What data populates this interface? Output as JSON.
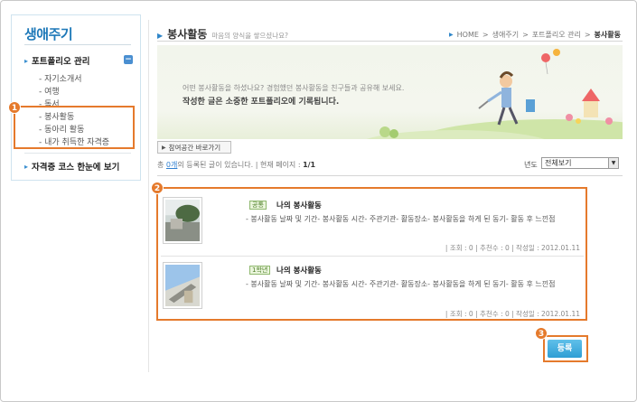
{
  "sidebar": {
    "title": "생애주기",
    "section1": "포트폴리오 관리",
    "items": [
      "자기소개서",
      "여행",
      "독서",
      "봉사활동",
      "동아리 활동",
      "내가 취득한 자격증"
    ],
    "section2": "자격증 코스 한눈에 보기"
  },
  "header": {
    "title": "봉사활동",
    "subtitle": "마음의 양식을 쌓으셨나요?",
    "breadcrumb": [
      "HOME",
      "생애주기",
      "포트폴리오 관리",
      "봉사활동"
    ]
  },
  "banner": {
    "line1": "어떤 봉사활동을 하셨나요? 경험했던 봉사활동을 친구들과 공유해 보세요.",
    "line2": "작성한 글은 소중한 포트폴리오에 기록됩니다."
  },
  "shortcut_label": "참여공간 바로가기",
  "count": {
    "prefix": "총",
    "number": "0개",
    "suffix": "의 등록된 글이 있습니다. | 현재 페이지 :",
    "page": "1/1"
  },
  "year": {
    "label": "년도",
    "selected": "전체보기"
  },
  "posts": [
    {
      "tag": "공통",
      "title": "나의 봉사활동",
      "desc": "- 봉사활동 날짜 및 기간- 봉사활동 시간- 주관기관- 활동장소- 봉사활동을 하게 된 동기- 활동 후 느낀점",
      "meta": "| 조회 : 0  | 추천수 : 0  | 작성일 : 2012.01.11"
    },
    {
      "tag": "1학년",
      "title": "나의 봉사활동",
      "desc": "- 봉사활동 날짜 및 기간- 봉사활동 시간- 주관기관- 활동장소- 봉사활동을 하게 된 동기- 활동 후 느낀점",
      "meta": "| 조회 : 0  | 추천수 : 0  | 작성일 : 2012.01.11"
    }
  ],
  "register_label": "등록",
  "badges": [
    "1",
    "2",
    "3"
  ],
  "colors": {
    "accent": "#2f86c8",
    "highlight": "#e57a2c",
    "button": "#3aa9de"
  }
}
